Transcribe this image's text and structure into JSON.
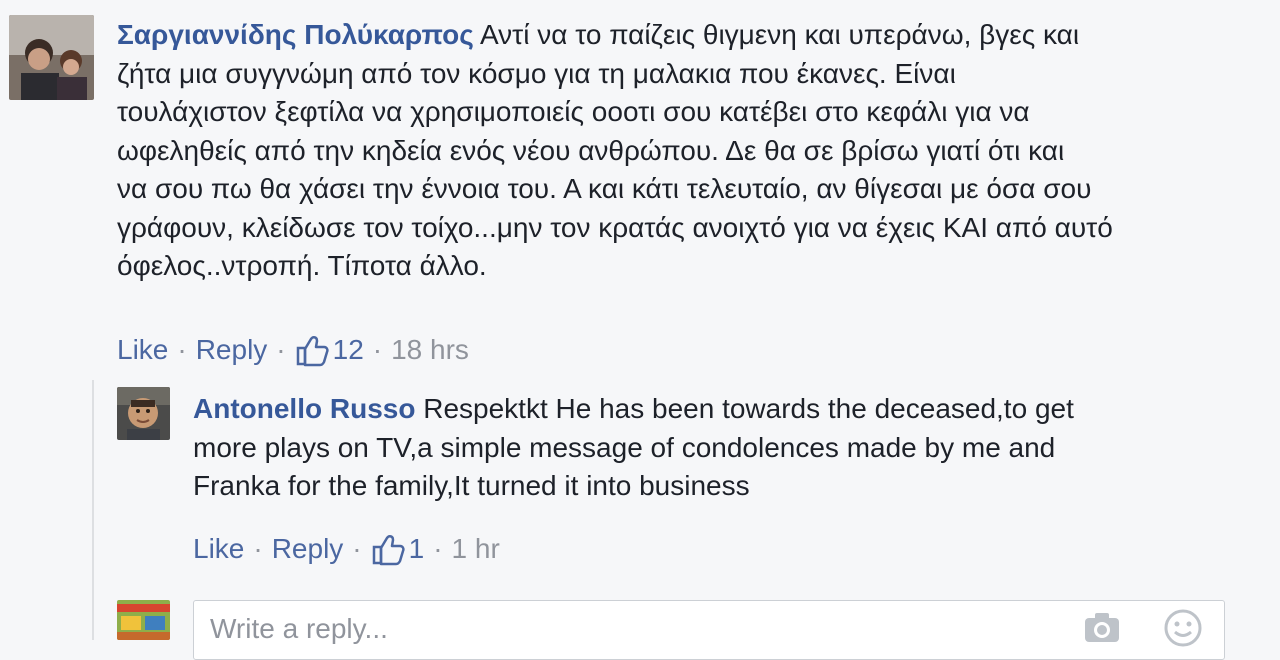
{
  "comment1": {
    "author": "Σαργιαννίδης Πολύκαρπος",
    "lines": [
      "Αντί να το παίζεις θιγμενη και υπεράνω, βγες και",
      "ζήτα μια συγγνώμη από τον κόσμο για τη μαλακια που έκανες. Είναι",
      "τουλάχιστον ξεφτίλα να χρησιμοποιείς οοοτι σου κατέβει στο κεφάλι για να",
      "ωφεληθείς από την κηδεία ενός νέου ανθρώπου. Δε θα σε βρίσω γιατί ότι και",
      "να σου πω θα χάσει την έννοια του. Α και κάτι τελευταίο, αν θίγεσαι με όσα σου",
      "γράφουν, κλείδωσε τον τοίχο...μην τον κρατάς ανοιχτό για να έχεις ΚΑΙ από αυτό",
      "όφελος..ντροπή. Τίποτα άλλο."
    ],
    "like_label": "Like",
    "reply_label": "Reply",
    "likes_count": "12",
    "time": "18 hrs"
  },
  "comment2": {
    "author": "Antonello Russo",
    "lines": [
      "Respektkt He has been towards the deceased,to get",
      "more plays on TV,a simple message of condolences made by me and",
      "Franka for the family,It turned it into business"
    ],
    "like_label": "Like",
    "reply_label": "Reply",
    "likes_count": "1",
    "time": "1 hr"
  },
  "reply_input": {
    "placeholder": "Write a reply..."
  },
  "icons": {
    "like": "thumbs-up-icon",
    "camera": "camera-icon",
    "emoji": "emoji-icon"
  },
  "colors": {
    "author": "#365899",
    "link": "#4b67a1",
    "meta": "#90949c",
    "background": "#f6f7f9"
  }
}
